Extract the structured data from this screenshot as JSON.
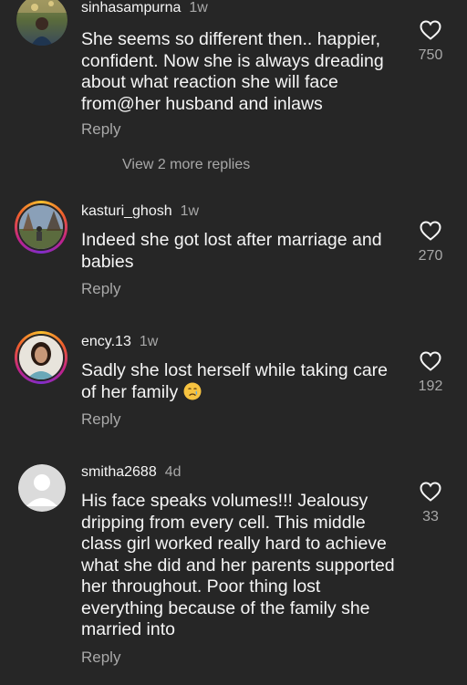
{
  "comments": [
    {
      "username": "sinhasampurna",
      "time": "1w",
      "text": "She seems so different then.. happier, confident. Now she is always dreading about what reaction she will face from@her husband and inlaws",
      "reply": "Reply",
      "likes": "750",
      "avatar": "photo-avatar"
    },
    {
      "username": "kasturi_ghosh",
      "time": "1w",
      "text": "Indeed she got lost after marriage and babies",
      "reply": "Reply",
      "likes": "270",
      "avatar": "story-ring-avatar"
    },
    {
      "username": "ency.13",
      "time": "1w",
      "text": "Sadly she lost herself while taking care of her family",
      "emoji": "crying-face",
      "reply": "Reply",
      "likes": "192",
      "avatar": "story-ring-avatar"
    },
    {
      "username": "smitha2688",
      "time": "4d",
      "text": "His face speaks volumes!!! Jealousy dripping from every cell.  This middle class girl worked really hard to achieve what she did and her parents supported her throughout.  Poor thing lost everything because of the family she married into",
      "reply": "Reply",
      "likes": "33",
      "avatar": "default-avatar"
    }
  ],
  "view_more_replies": "View 2 more replies",
  "colors": {
    "background": "#262626",
    "primary_text": "#f5f5f5",
    "secondary_text": "#a8a8a8",
    "story_ring": "#c1228a"
  }
}
